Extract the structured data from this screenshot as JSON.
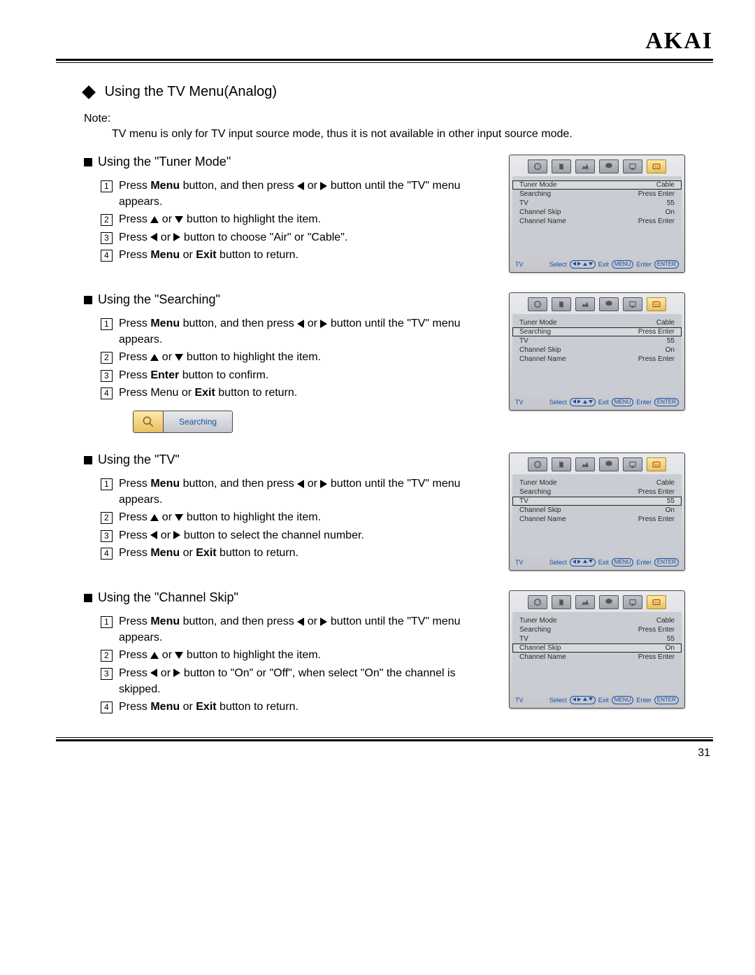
{
  "brand": "AKAI",
  "page_number": "31",
  "h1": "Using the TV Menu(Analog)",
  "note_label": "Note:",
  "note_body": "TV menu is only for TV input source mode, thus it is not available in other input source mode.",
  "searching_chip": "Searching",
  "osd_rows": [
    {
      "label": "Tuner Mode",
      "value": "Cable"
    },
    {
      "label": "Searching",
      "value": "Press Enter"
    },
    {
      "label": "TV",
      "value": "55"
    },
    {
      "label": "Channel Skip",
      "value": "On"
    },
    {
      "label": "Channel Name",
      "value": "Press Enter"
    }
  ],
  "osd_footer": {
    "tv": "TV",
    "select": "Select",
    "exit": "Exit",
    "menu": "MENU",
    "enter": "Enter",
    "enter2": "ENTER"
  },
  "sections": [
    {
      "title": "Using the \"Tuner Mode\"",
      "highlight": 0,
      "step3": {
        "pre": "Press ",
        "mid": " or ",
        "post": " button to choose \"Air\" or \"Cable\"."
      },
      "step4_variant": "bold_menu_exit"
    },
    {
      "title": "Using the \"Searching\"",
      "highlight": 1,
      "step3_text": "Press <b>Enter</b> button to confirm.",
      "step4_variant": "bold_exit_only",
      "has_chip": true
    },
    {
      "title": "Using the \"TV\"",
      "highlight": 2,
      "step3": {
        "pre": "Press ",
        "mid": " or ",
        "post": " button to select the channel number."
      },
      "step4_variant": "bold_menu_exit"
    },
    {
      "title": "Using the \"Channel Skip\"",
      "highlight": 3,
      "step3": {
        "pre": "Press ",
        "mid": " or ",
        "post": " button to \"On\" or \"Off\", when select \"On\" the channel is skipped."
      },
      "step4_variant": "bold_menu_exit"
    }
  ],
  "common_steps": {
    "s1a": "Press ",
    "s1b": "Menu",
    "s1c": " button, and then press ",
    "s1d": " or ",
    "s1e": " button until the \"TV\" menu appears.",
    "s2a": "Press ",
    "s2b": " or ",
    "s2c": " button to highlight the item.",
    "s4_bold_menu_exit_a": "Press ",
    "s4_bold_menu_exit_b": "Menu",
    "s4_bold_menu_exit_c": " or ",
    "s4_bold_menu_exit_d": "Exit",
    "s4_bold_menu_exit_e": " button to return.",
    "s4_bold_exit_only_a": "Press Menu or ",
    "s4_bold_exit_only_b": "Exit",
    "s4_bold_exit_only_c": " button to return."
  }
}
